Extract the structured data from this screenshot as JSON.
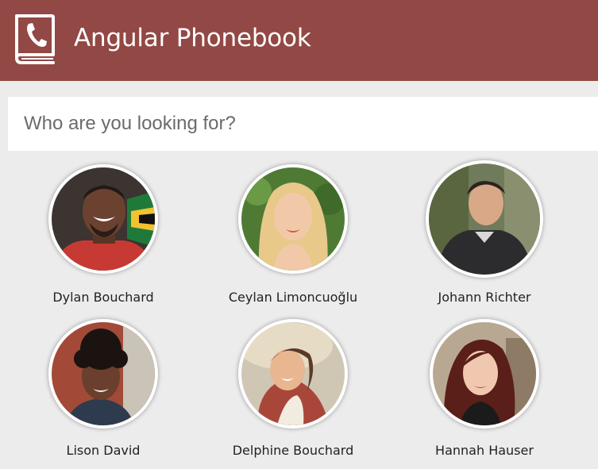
{
  "header": {
    "title": "Angular Phonebook",
    "logo_icon": "phonebook-icon",
    "background_color": "#924844"
  },
  "search": {
    "placeholder": "Who are you looking for?",
    "value": ""
  },
  "contacts": [
    {
      "name": "Dylan Bouchard"
    },
    {
      "name": "Ceylan Limoncuoğlu"
    },
    {
      "name": "Johann Richter"
    },
    {
      "name": "Lison David"
    },
    {
      "name": "Delphine Bouchard"
    },
    {
      "name": "Hannah Hauser"
    }
  ]
}
